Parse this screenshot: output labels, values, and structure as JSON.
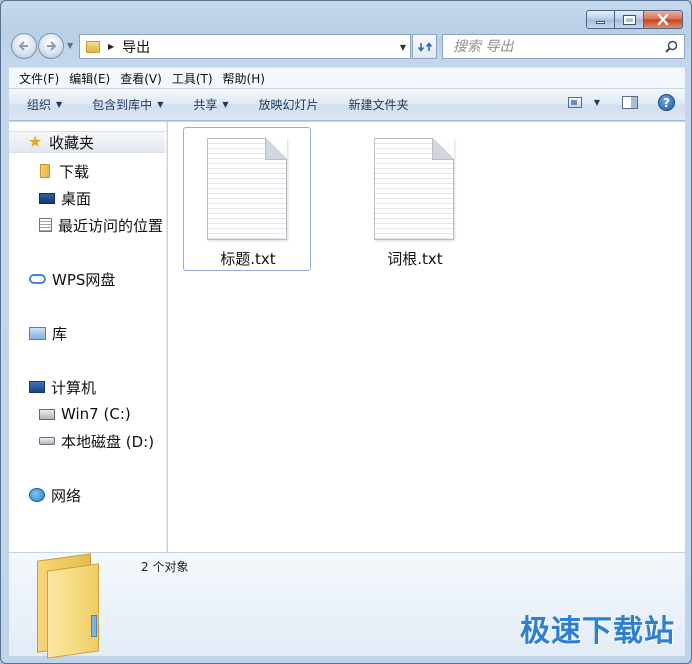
{
  "address": {
    "path": "导出"
  },
  "search": {
    "placeholder": "搜索 导出"
  },
  "menu": [
    "文件(F)",
    "编辑(E)",
    "查看(V)",
    "工具(T)",
    "帮助(H)"
  ],
  "commands": {
    "organize": "组织",
    "include_in_library": "包含到库中",
    "share": "共享",
    "slideshow": "放映幻灯片",
    "new_folder": "新建文件夹"
  },
  "nav": {
    "favorites": "收藏夹",
    "downloads": "下载",
    "desktop": "桌面",
    "recent": "最近访问的位置",
    "wps": "WPS网盘",
    "libraries": "库",
    "computer": "计算机",
    "drive_c": "Win7 (C:)",
    "drive_d": "本地磁盘 (D:)",
    "network": "网络"
  },
  "files": [
    {
      "name": "标题.txt",
      "selected": true
    },
    {
      "name": "词根.txt",
      "selected": false
    }
  ],
  "status": {
    "count": "2 个对象"
  },
  "watermark": "极速下载站",
  "icons": {
    "favorites": "star-icon",
    "folder": "folder-icon",
    "desktop": "desktop-icon",
    "recent": "recent-places-icon",
    "cloud": "cloud-icon",
    "libraries": "library-icon",
    "computer": "computer-icon",
    "drive": "drive-icon",
    "network": "network-icon",
    "help": "help-icon"
  },
  "colors": {
    "accent": "#1e395b",
    "watermark": "#2f7fd1",
    "selection": "#8fb2d6"
  }
}
